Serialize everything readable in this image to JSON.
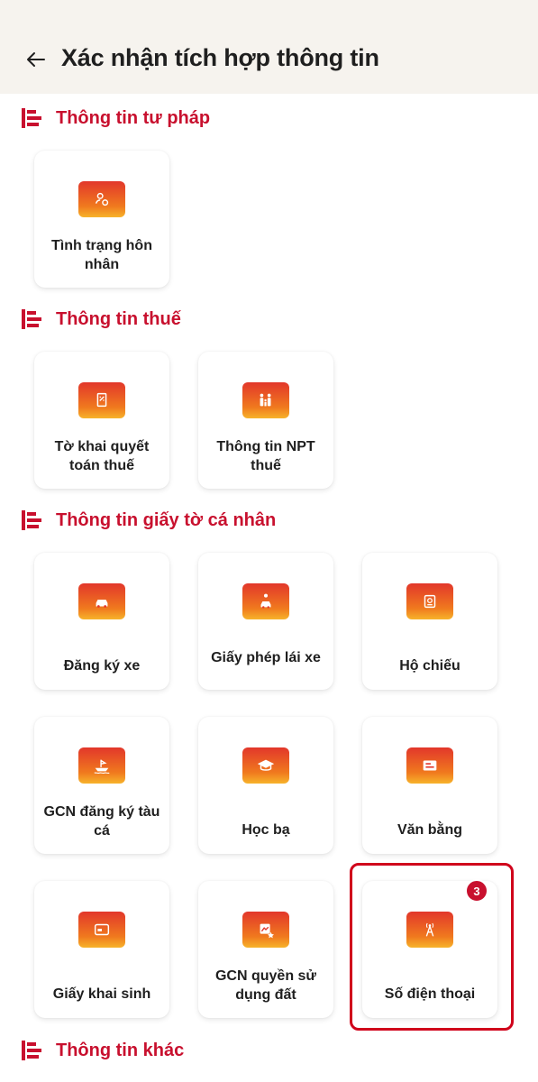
{
  "header": {
    "title": "Xác nhận tích hợp thông tin"
  },
  "sections": [
    {
      "title": "Thông tin tư pháp"
    },
    {
      "title": "Thông tin thuế"
    },
    {
      "title": "Thông tin giấy tờ cá nhân"
    },
    {
      "title": "Thông tin khác"
    }
  ],
  "cards": {
    "marriage_status": "Tình trạng hôn nhân",
    "tax_settlement": "Tờ khai quyết toán thuế",
    "dependent_info": "Thông tin NPT thuế",
    "vehicle_registration": "Đăng ký xe",
    "driving_license": "Giấy phép lái xe",
    "passport": "Hộ chiếu",
    "fishing_boat": "GCN đăng ký tàu cá",
    "school_record": "Học bạ",
    "diploma": "Văn bằng",
    "birth_certificate": "Giấy khai sinh",
    "land_use": "GCN quyền sử dụng đất",
    "phone_number": "Số điện thoại",
    "phone_number_badge": "3"
  },
  "colors": {
    "accent": "#c8102e",
    "header_bg": "#f6f3ee",
    "tile_top": "#e2372b",
    "tile_bottom": "#f7b32b"
  },
  "icons": {
    "back": "arrow-left-icon",
    "section": "list-bars-icon"
  }
}
